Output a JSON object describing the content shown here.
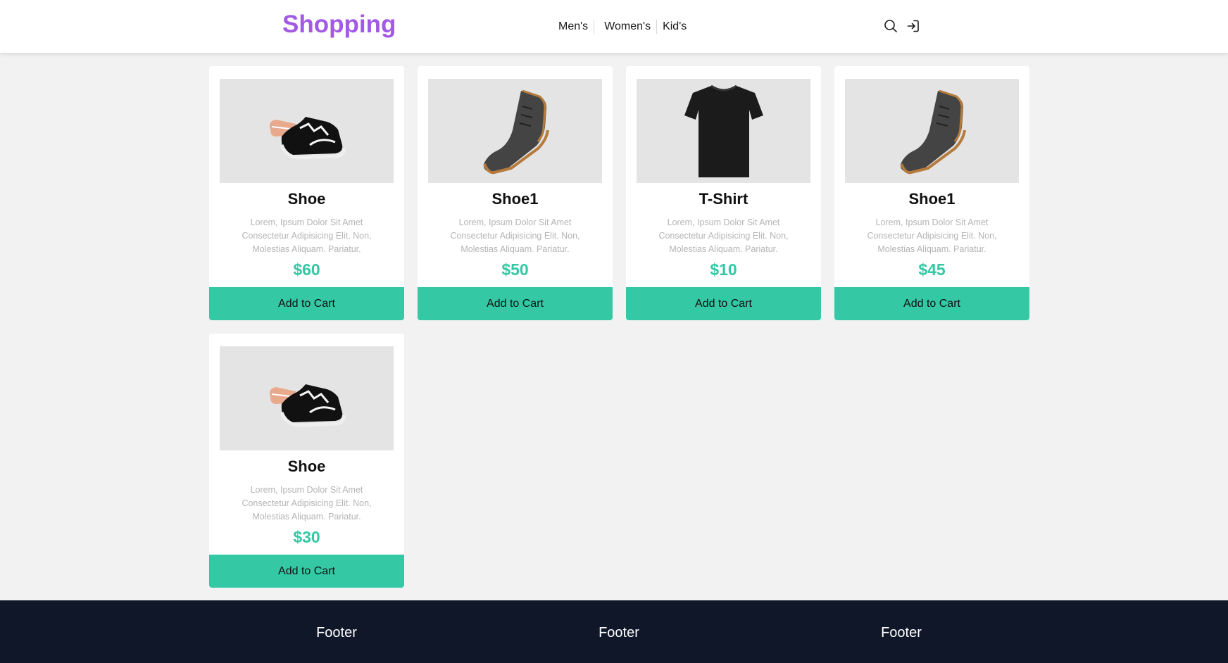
{
  "header": {
    "brand": "Shopping",
    "nav": [
      "Men's",
      "Women's",
      "Kid's"
    ],
    "icons": [
      "search-icon",
      "login-icon"
    ],
    "brand_color": "#a259e6"
  },
  "products": [
    {
      "name": "Shoe",
      "description": "Lorem, Ipsum Dolor Sit Amet Consectetur Adipisicing Elit. Non, Molestias Aliquam. Pariatur.",
      "price": "$60",
      "button": "Add to Cart",
      "image": "sneaker-image"
    },
    {
      "name": "Shoe1",
      "description": "Lorem, Ipsum Dolor Sit Amet Consectetur Adipisicing Elit. Non, Molestias Aliquam. Pariatur.",
      "price": "$50",
      "button": "Add to Cart",
      "image": "boot-image"
    },
    {
      "name": "T-Shirt",
      "description": "Lorem, Ipsum Dolor Sit Amet Consectetur Adipisicing Elit. Non, Molestias Aliquam. Pariatur.",
      "price": "$10",
      "button": "Add to Cart",
      "image": "tshirt-image"
    },
    {
      "name": "Shoe1",
      "description": "Lorem, Ipsum Dolor Sit Amet Consectetur Adipisicing Elit. Non, Molestias Aliquam. Pariatur.",
      "price": "$45",
      "button": "Add to Cart",
      "image": "boot-image"
    },
    {
      "name": "Shoe",
      "description": "Lorem, Ipsum Dolor Sit Amet Consectetur Adipisicing Elit. Non, Molestias Aliquam. Pariatur.",
      "price": "$30",
      "button": "Add to Cart",
      "image": "sneaker-image"
    }
  ],
  "footer": {
    "columns": [
      "Footer",
      "Footer",
      "Footer"
    ]
  },
  "colors": {
    "accent": "#34c8a5",
    "footer_bg": "#0f1729",
    "page_bg": "#f2f2f2"
  }
}
